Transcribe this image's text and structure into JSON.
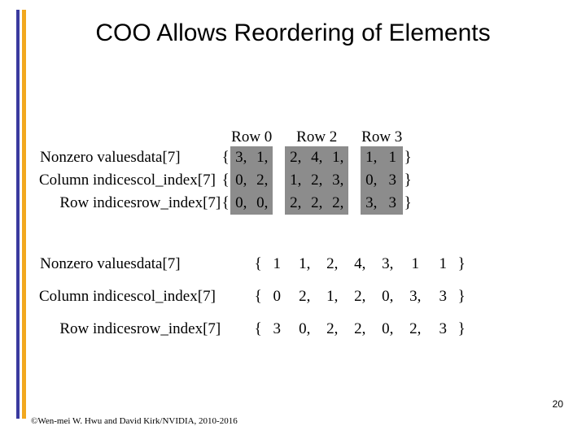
{
  "slide": {
    "title": "COO Allows Reordering of Elements",
    "page_number": "20",
    "copyright": "©Wen-mei W. Hwu and David Kirk/NVIDIA, 2010-2016",
    "accent_blue": "#3a3a9e",
    "accent_orange": "#f2a81e",
    "highlight_gray": "#8c8c8c"
  },
  "labels": {
    "nonzero_values": "Nonzero values",
    "column_indices": "Column indices",
    "row_indices": "Row indices",
    "data_var": "data[7]",
    "col_index_var": "col_index[7]",
    "row_index_var": "row_index[7]",
    "open_brace": "{",
    "close_brace": "}"
  },
  "top_table": {
    "group_headers": [
      "Row 0",
      "Row 2",
      "Row 3"
    ],
    "rows": [
      {
        "desc": "Nonzero values",
        "var": "data[7]",
        "groups": [
          [
            "3,",
            "1,"
          ],
          [
            "2,",
            "4,",
            "1,"
          ],
          [
            "1,",
            "1"
          ]
        ]
      },
      {
        "desc": "Column indices",
        "var": "col_index[7]",
        "groups": [
          [
            "0,",
            "2,"
          ],
          [
            "1,",
            "2,",
            "3,"
          ],
          [
            "0,",
            "3"
          ]
        ]
      },
      {
        "desc": "Row indices",
        "var": "row_index[7]",
        "groups": [
          [
            "0,",
            "0,"
          ],
          [
            "2,",
            "2,",
            "2,"
          ],
          [
            "3,",
            "3"
          ]
        ]
      }
    ]
  },
  "bottom_table": {
    "rows": [
      {
        "desc": "Nonzero values",
        "var": "data[7]",
        "values": [
          "1",
          "1,",
          "2,",
          "4,",
          "3,",
          "1",
          "1"
        ]
      },
      {
        "desc": "Column indices",
        "var": "col_index[7]",
        "values": [
          "0",
          "2,",
          "1,",
          "2,",
          "0,",
          "3,",
          "3"
        ]
      },
      {
        "desc": "Row indices",
        "var": "row_index[7]",
        "values": [
          "3",
          "0,",
          "2,",
          "2,",
          "0,",
          "2,",
          "3"
        ]
      }
    ]
  }
}
